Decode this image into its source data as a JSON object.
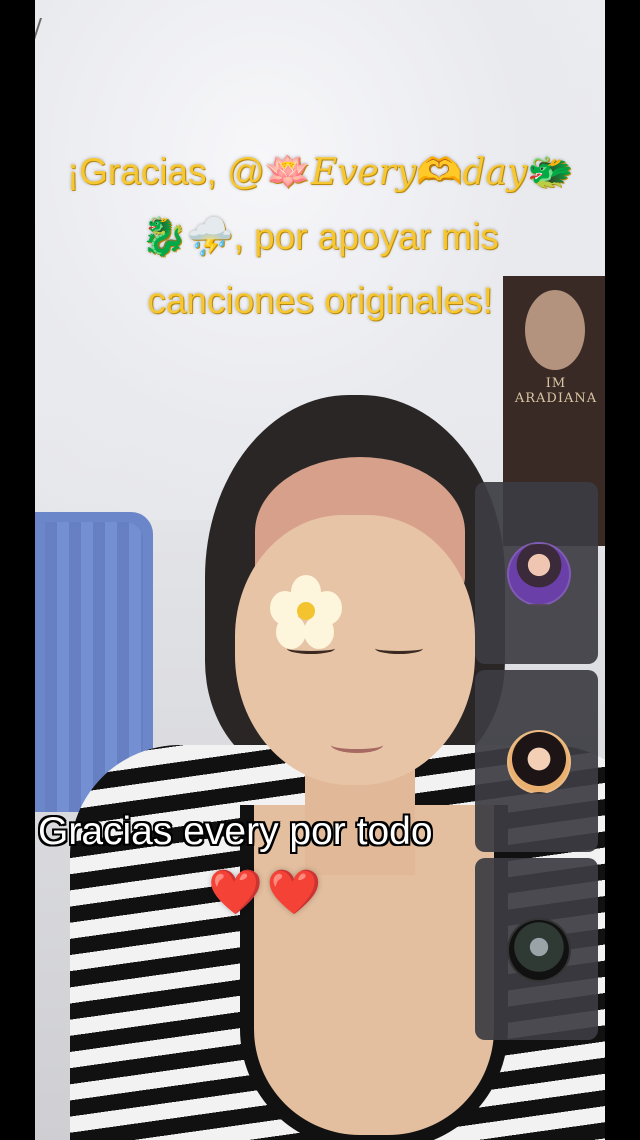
{
  "thanks_overlay": {
    "line1_prefix": "¡Gracias, @",
    "lotus_icon": "🪷",
    "username_part1": "Every",
    "heart_hands_icon": "🫶",
    "username_part2": "day",
    "dragon_face_icon": "🐲",
    "dragon_icon": "🐉",
    "storm_cloud_icon": "⛈️",
    "line2_text": ", por apoyar mis",
    "line3_text": "canciones originales!"
  },
  "caption": {
    "text": "Gracias every por todo",
    "hearts": "❤️❤️"
  },
  "participants": [
    {
      "avatar": "avatar-1"
    },
    {
      "avatar": "avatar-2"
    },
    {
      "avatar": "avatar-3"
    }
  ],
  "poster": {
    "text": "IM\nARADIANA"
  },
  "colors": {
    "accent_yellow": "#f6c733",
    "caption_white": "#ffffff",
    "panel_bg": "#3c3c42"
  }
}
